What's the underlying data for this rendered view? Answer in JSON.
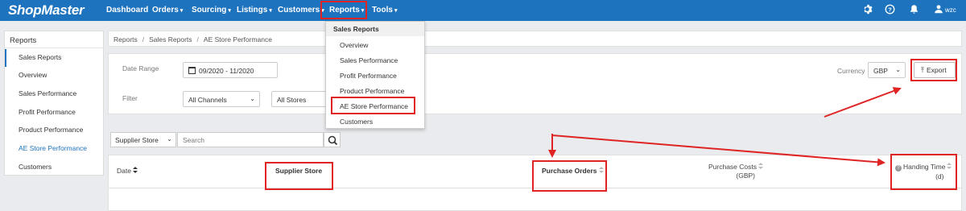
{
  "brand": "ShopMaster",
  "nav": {
    "items": [
      {
        "label": "Dashboard",
        "caret": false
      },
      {
        "label": "Orders",
        "caret": true
      },
      {
        "label": "Sourcing",
        "caret": true
      },
      {
        "label": "Listings",
        "caret": true
      },
      {
        "label": "Customers",
        "caret": true
      },
      {
        "label": "Reports",
        "caret": true
      },
      {
        "label": "Tools",
        "caret": true
      }
    ],
    "user": "wzc"
  },
  "sidebar": {
    "title": "Reports",
    "items": [
      {
        "label": "Sales Reports"
      },
      {
        "label": "Overview"
      },
      {
        "label": "Sales Performance"
      },
      {
        "label": "Profit Performance"
      },
      {
        "label": "Product Performance"
      },
      {
        "label": "AE Store Performance"
      },
      {
        "label": "Customers"
      }
    ]
  },
  "breadcrumb": [
    "Reports",
    "Sales Reports",
    "AE Store Performance"
  ],
  "filters": {
    "date_range_label": "Date Range",
    "date_range_value": "09/2020 - 11/2020",
    "filter_label": "Filter",
    "channel_value": "All Channels",
    "store_value": "All Stores",
    "currency_label": "Currency",
    "currency_value": "GBP",
    "export_label": "Export"
  },
  "search": {
    "field_value": "Supplier Store",
    "placeholder": "Search"
  },
  "table": {
    "columns": [
      {
        "label": "Date"
      },
      {
        "label": "Supplier Store"
      },
      {
        "label": "Purchase Orders"
      },
      {
        "label": "Purchase Costs",
        "sub": "(GBP)"
      },
      {
        "label": "Handing Time",
        "sub": "(d)"
      }
    ]
  },
  "reports_menu": {
    "header": "Sales Reports",
    "items": [
      "Overview",
      "Sales Performance",
      "Profit Performance",
      "Product Performance",
      "AE Store Performance",
      "Customers"
    ]
  },
  "colors": {
    "nav_bg": "#1e73be",
    "accent": "#1e73be",
    "annotation": "#e02424"
  }
}
